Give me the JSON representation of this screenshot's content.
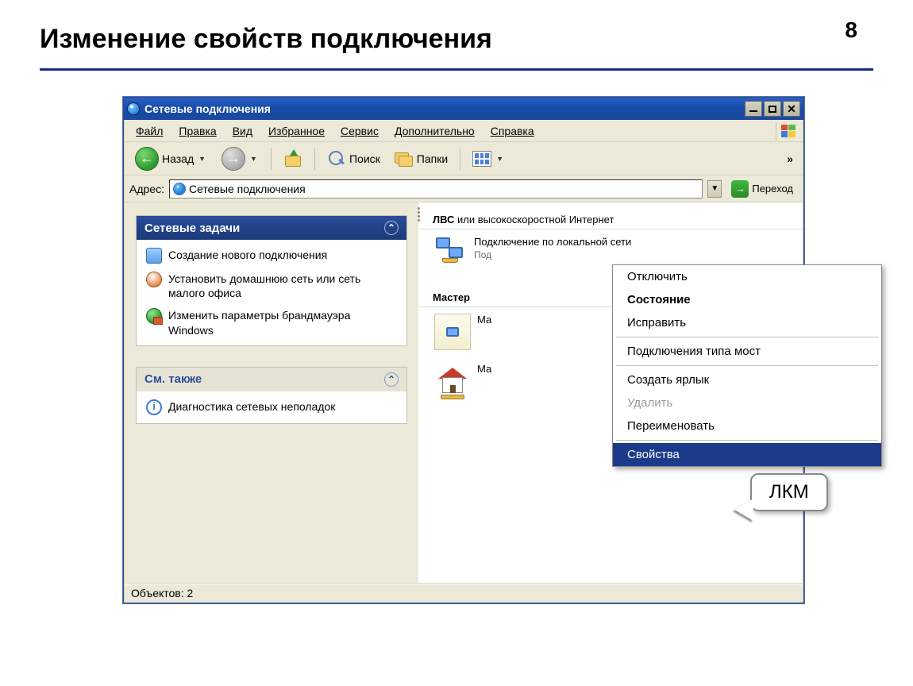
{
  "slide": {
    "title": "Изменение свойств подключения",
    "number": "8"
  },
  "window": {
    "title": "Сетевые подключения",
    "menubar": [
      "Файл",
      "Правка",
      "Вид",
      "Избранное",
      "Сервис",
      "Дополнительно",
      "Справка"
    ],
    "toolbar": {
      "back": "Назад",
      "search": "Поиск",
      "folders": "Папки"
    },
    "address": {
      "label": "Адрес:",
      "value": "Сетевые подключения",
      "go": "Переход"
    },
    "left": {
      "panel1": {
        "title": "Сетевые задачи",
        "items": [
          "Создание нового подключения",
          "Установить домашнюю сеть или сеть малого офиса",
          "Изменить параметры брандмауэра Windows"
        ]
      },
      "panel2": {
        "title": "См. также",
        "items": [
          "Диагностика сетевых неполадок"
        ]
      }
    },
    "right": {
      "group1": {
        "bold": "ЛВС",
        "rest": " или высокоскоростной Интернет"
      },
      "conn": {
        "name": "Подключение по локальной сети",
        "sub": "Под"
      },
      "group2": "Мастер",
      "wiz1": "Ма",
      "wiz2": "Ма"
    },
    "context": {
      "items": [
        {
          "label": "Отключить"
        },
        {
          "label": "Состояние",
          "bold": true
        },
        {
          "label": "Исправить"
        },
        {
          "sep": true
        },
        {
          "label": "Подключения типа мост"
        },
        {
          "sep": true
        },
        {
          "label": "Создать ярлык"
        },
        {
          "label": "Удалить",
          "disabled": true
        },
        {
          "label": "Переименовать"
        },
        {
          "sep": true
        },
        {
          "label": "Свойства",
          "highlight": true
        }
      ]
    },
    "status": "Объектов: 2"
  },
  "callout": "ЛКМ"
}
